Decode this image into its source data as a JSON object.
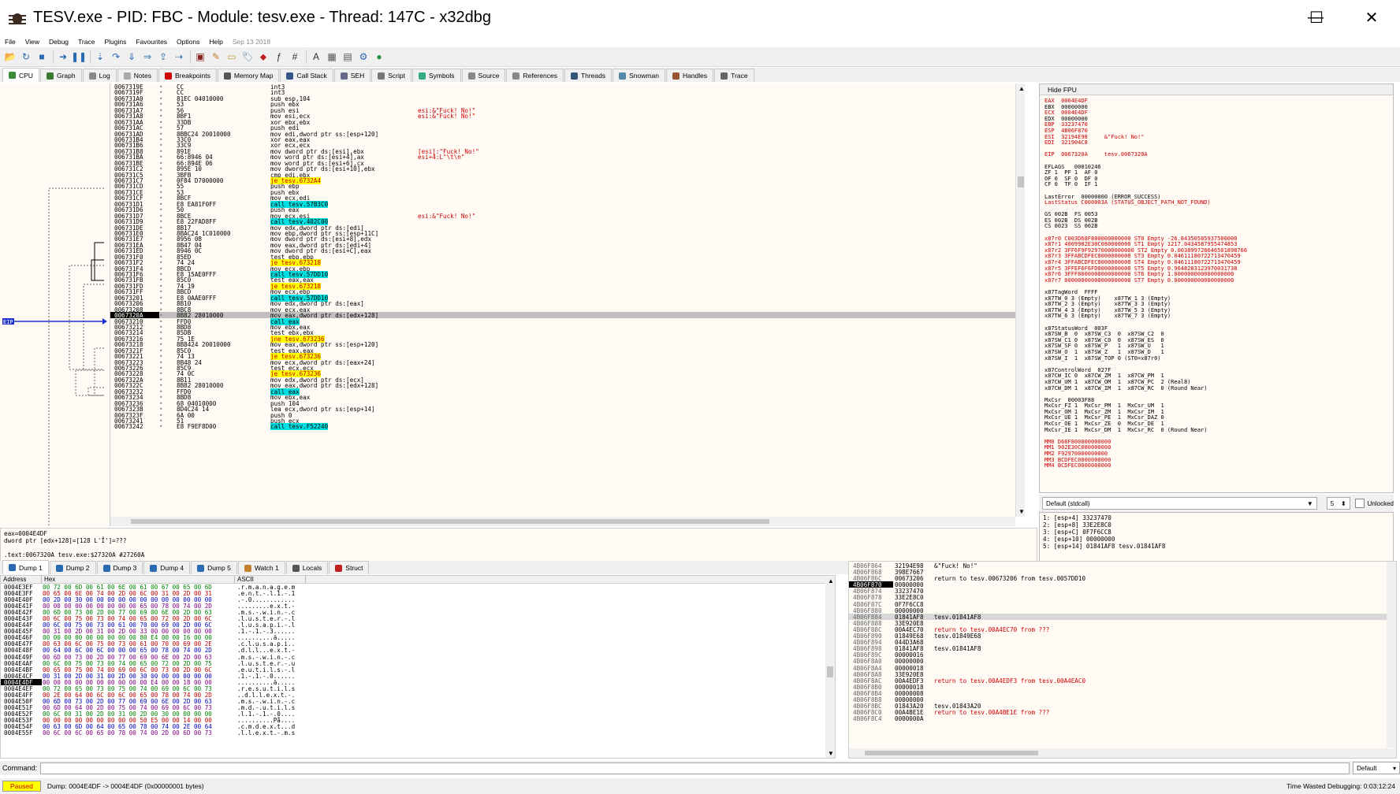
{
  "window": {
    "title": "TESV.exe - PID: FBC - Module: tesv.exe - Thread: 147C - x32dbg",
    "minimize": "—",
    "maximize": "☐",
    "close": "✕"
  },
  "menu": [
    "File",
    "View",
    "Debug",
    "Trace",
    "Plugins",
    "Favourites",
    "Options",
    "Help"
  ],
  "menu_date": "Sep 13 2018",
  "toolbar_icons": [
    "open-icon",
    "restart-icon",
    "stop-icon",
    "run-icon",
    "pause-icon",
    "step-into-icon",
    "step-over-icon",
    "trace-into-icon",
    "trace-over-icon",
    "execute-till-return-icon",
    "run-to-user-code-icon",
    "scylla-icon",
    "patch-icon",
    "comment-icon",
    "label-icon",
    "bookmark-icon",
    "function-icon",
    "hash-icon",
    "font-icon",
    "calculator-icon",
    "notes-icon",
    "settings-icon",
    "about-icon"
  ],
  "tabs": [
    {
      "label": "CPU",
      "color": "#3a8a3a"
    },
    {
      "label": "Graph",
      "color": "#3a7a30"
    },
    {
      "label": "Log",
      "color": "#888"
    },
    {
      "label": "Notes",
      "color": "#aaa"
    },
    {
      "label": "Breakpoints",
      "color": "#c00"
    },
    {
      "label": "Memory Map",
      "color": "#555"
    },
    {
      "label": "Call Stack",
      "color": "#358"
    },
    {
      "label": "SEH",
      "color": "#668"
    },
    {
      "label": "Script",
      "color": "#777"
    },
    {
      "label": "Symbols",
      "color": "#3a8"
    },
    {
      "label": "Source",
      "color": "#888"
    },
    {
      "label": "References",
      "color": "#888"
    },
    {
      "label": "Threads",
      "color": "#357"
    },
    {
      "label": "Snowman",
      "color": "#58a"
    },
    {
      "label": "Handles",
      "color": "#953"
    },
    {
      "label": "Trace",
      "color": "#666"
    }
  ],
  "disasm": [
    {
      "a": "0067319E",
      "b": "CC",
      "i": "int3",
      "c": "",
      "t": ""
    },
    {
      "a": "0067319F",
      "b": "CC",
      "i": "int3",
      "c": "",
      "t": ""
    },
    {
      "a": "006731A0",
      "b": "81EC 04010000",
      "i": "sub esp,104",
      "c": "",
      "t": ""
    },
    {
      "a": "006731A6",
      "b": "53",
      "i": "push ebx",
      "c": "",
      "t": ""
    },
    {
      "a": "006731A7",
      "b": "56",
      "i": "push esi",
      "c": "esi:&\"Fuck! No!\"",
      "t": ""
    },
    {
      "a": "006731A8",
      "b": "8BF1",
      "i": "mov esi,ecx",
      "c": "esi:&\"Fuck! No!\"",
      "t": ""
    },
    {
      "a": "006731AA",
      "b": "33DB",
      "i": "xor ebx,ebx",
      "c": "",
      "t": ""
    },
    {
      "a": "006731AC",
      "b": "57",
      "i": "push edi",
      "c": "",
      "t": ""
    },
    {
      "a": "006731AD",
      "b": "8BBC24 20010000",
      "i": "mov edi,dword ptr ss:[esp+120]",
      "c": "",
      "t": ""
    },
    {
      "a": "006731B4",
      "b": "33C0",
      "i": "xor eax,eax",
      "c": "",
      "t": ""
    },
    {
      "a": "006731B6",
      "b": "33C9",
      "i": "xor ecx,ecx",
      "c": "",
      "t": ""
    },
    {
      "a": "006731B8",
      "b": "891E",
      "i": "mov dword ptr ds:[esi],ebx",
      "c": "[esi]:\"Fuck! No!\"",
      "t": ""
    },
    {
      "a": "006731BA",
      "b": "66:8946 04",
      "i": "mov word ptr ds:[esi+4],ax",
      "c": "esi+4:L\"\\t\\n\"",
      "t": ""
    },
    {
      "a": "006731BE",
      "b": "66:894E 06",
      "i": "mov word ptr ds:[esi+6],cx",
      "c": "",
      "t": ""
    },
    {
      "a": "006731C2",
      "b": "895E 10",
      "i": "mov dword ptr ds:[esi+10],ebx",
      "c": "",
      "t": ""
    },
    {
      "a": "006731C5",
      "b": "3BFB",
      "i": "cmp edi,ebx",
      "c": "",
      "t": ""
    },
    {
      "a": "006731C7",
      "b": "0F84 D7000000",
      "i": "je tesv.6732A4",
      "c": "",
      "t": "j"
    },
    {
      "a": "006731CD",
      "b": "55",
      "i": "push ebp",
      "c": "",
      "t": ""
    },
    {
      "a": "006731CE",
      "b": "53",
      "i": "push ebx",
      "c": "",
      "t": ""
    },
    {
      "a": "006731CF",
      "b": "8BCF",
      "i": "mov ecx,edi",
      "c": "",
      "t": ""
    },
    {
      "a": "006731D1",
      "b": "E8 EA81F0FF",
      "i": "call tesv.57B3C0",
      "c": "",
      "t": "c"
    },
    {
      "a": "006731D6",
      "b": "50",
      "i": "push eax",
      "c": "",
      "t": ""
    },
    {
      "a": "006731D7",
      "b": "8BCE",
      "i": "mov ecx,esi",
      "c": "esi:&\"Fuck! No!\"",
      "t": ""
    },
    {
      "a": "006731D9",
      "b": "E8 22FAD8FF",
      "i": "call tesv.402C00",
      "c": "",
      "t": "c"
    },
    {
      "a": "006731DE",
      "b": "8B17",
      "i": "mov edx,dword ptr ds:[edi]",
      "c": "",
      "t": ""
    },
    {
      "a": "006731E0",
      "b": "8BAC24 1C010000",
      "i": "mov ebp,dword ptr ss:[esp+11C]",
      "c": "",
      "t": ""
    },
    {
      "a": "006731E7",
      "b": "8956 08",
      "i": "mov dword ptr ds:[esi+8],edx",
      "c": "",
      "t": ""
    },
    {
      "a": "006731EA",
      "b": "8B47 04",
      "i": "mov eax,dword ptr ds:[edi+4]",
      "c": "",
      "t": ""
    },
    {
      "a": "006731ED",
      "b": "8946 0C",
      "i": "mov dword ptr ds:[esi+C],eax",
      "c": "",
      "t": ""
    },
    {
      "a": "006731F0",
      "b": "85ED",
      "i": "test ebp,ebp",
      "c": "",
      "t": ""
    },
    {
      "a": "006731F2",
      "b": "74 24",
      "i": "je tesv.673218",
      "c": "",
      "t": "j"
    },
    {
      "a": "006731F4",
      "b": "8BCD",
      "i": "mov ecx,ebp",
      "c": "",
      "t": ""
    },
    {
      "a": "006731F6",
      "b": "E8 15AE0FFF",
      "i": "call tesv.57DD10",
      "c": "",
      "t": "c"
    },
    {
      "a": "006731FB",
      "b": "85C0",
      "i": "test eax,eax",
      "c": "",
      "t": ""
    },
    {
      "a": "006731FD",
      "b": "74 19",
      "i": "je tesv.673218",
      "c": "",
      "t": "j"
    },
    {
      "a": "006731FF",
      "b": "8BCD",
      "i": "mov ecx,ebp",
      "c": "",
      "t": ""
    },
    {
      "a": "00673201",
      "b": "E8 0AAE0FFF",
      "i": "call tesv.57DD10",
      "c": "",
      "t": "c"
    },
    {
      "a": "00673206",
      "b": "8B10",
      "i": "mov edx,dword ptr ds:[eax]",
      "c": "",
      "t": ""
    },
    {
      "a": "00673208",
      "b": "8BC8",
      "i": "mov ecx,eax",
      "c": "",
      "t": ""
    },
    {
      "a": "0067320A",
      "b": "8B82 28010000",
      "i": "mov eax,dword ptr ds:[edx+128]",
      "c": "",
      "t": "eip"
    },
    {
      "a": "00673210",
      "b": "FFD0",
      "i": "call eax",
      "c": "",
      "t": "c"
    },
    {
      "a": "00673212",
      "b": "8BD8",
      "i": "mov ebx,eax",
      "c": "",
      "t": ""
    },
    {
      "a": "00673214",
      "b": "85DB",
      "i": "test ebx,ebx",
      "c": "",
      "t": ""
    },
    {
      "a": "00673216",
      "b": "75 1E",
      "i": "jne tesv.673236",
      "c": "",
      "t": "j"
    },
    {
      "a": "00673218",
      "b": "8B8424 20010000",
      "i": "mov eax,dword ptr ss:[esp+120]",
      "c": "",
      "t": ""
    },
    {
      "a": "0067321F",
      "b": "85C0",
      "i": "test eax,eax",
      "c": "",
      "t": ""
    },
    {
      "a": "00673221",
      "b": "74 13",
      "i": "je tesv.673236",
      "c": "",
      "t": "j"
    },
    {
      "a": "00673223",
      "b": "8B48 24",
      "i": "mov ecx,dword ptr ds:[eax+24]",
      "c": "",
      "t": ""
    },
    {
      "a": "00673226",
      "b": "85C9",
      "i": "test ecx,ecx",
      "c": "",
      "t": ""
    },
    {
      "a": "00673228",
      "b": "74 0C",
      "i": "je tesv.673236",
      "c": "",
      "t": "j"
    },
    {
      "a": "0067322A",
      "b": "8B11",
      "i": "mov edx,dword ptr ds:[ecx]",
      "c": "",
      "t": ""
    },
    {
      "a": "0067322C",
      "b": "8B82 28010000",
      "i": "mov eax,dword ptr ds:[edx+128]",
      "c": "",
      "t": ""
    },
    {
      "a": "00673232",
      "b": "FFD0",
      "i": "call eax",
      "c": "",
      "t": "c"
    },
    {
      "a": "00673234",
      "b": "8BD8",
      "i": "mov ebx,eax",
      "c": "",
      "t": ""
    },
    {
      "a": "00673236",
      "b": "68 04010000",
      "i": "push 104",
      "c": "",
      "t": ""
    },
    {
      "a": "0067323B",
      "b": "8D4C24 14",
      "i": "lea ecx,dword ptr ss:[esp+14]",
      "c": "",
      "t": ""
    },
    {
      "a": "0067323F",
      "b": "6A 00",
      "i": "push 0",
      "c": "",
      "t": ""
    },
    {
      "a": "00673241",
      "b": "51",
      "i": "push ecx",
      "c": "",
      "t": ""
    },
    {
      "a": "00673242",
      "b": "E8 F9EF8D00",
      "i": "call tesv.F52240",
      "c": "",
      "t": "c"
    }
  ],
  "eip_label": "EIP",
  "regs_header": "Hide FPU",
  "regs": [
    "EAX  0004E4DF",
    "EBX  00000000",
    "ECX  0004E4DF",
    "EDX  00000000",
    "EBP  33237470",
    "ESP  4B06F870",
    "ESI  32194E98     &\"Fuck! No!\"",
    "EDI  321904C8",
    "",
    "EIP  0067320A     tesv.0067320A",
    "",
    "EFLAGS   00010246",
    "ZF 1  PF 1  AF 0",
    "OF 0  SF 0  DF 0",
    "CF 0  TF 0  IF 1",
    "",
    "LastError  00000000 (ERROR_SUCCESS)",
    "LastStatus C000003A (STATUS_OBJECT_PATH_NOT_FOUND)",
    "",
    "GS 002B  FS 0053",
    "ES 002B  DS 002B",
    "CS 0023  SS 002B",
    "",
    "x87r0 C003D68F800000000000 ST0 Empty -26.84350585937500000",
    "x87r1 4009902E30C080000000 ST1 Empty 1217.0434587955474853",
    "x87r2 3FF6F9F92970000000000 ST2 Empty 0.003899728646501898766",
    "x87r3 3FFABCDFEC0000000000 ST3 Empty 0.04611180722713470459",
    "x87r4 3FFABCDFEC0000000000 ST4 Empty 0.04611180722713470459",
    "x87r5 3FFEF6F6FD0000000000 ST5 Empty 0.9648283123970031738",
    "x87r6 3FFF8000000000000000 ST6 Empty 1.000000000000000000",
    "x87r7 00000000000000000000 ST7 Empty 0.000000000000000000",
    "",
    "x87TagWord  FFFF",
    "x87TW_0 3 (Empty)    x87TW_1 3 (Empty)",
    "x87TW_2 3 (Empty)    x87TW_3 3 (Empty)",
    "x87TW_4 3 (Empty)    x87TW_5 3 (Empty)",
    "x87TW_6 3 (Empty)    x87TW_7 3 (Empty)",
    "",
    "x87StatusWord  003F",
    "x87SW_B  0  x87SW_C3  0  x87SW_C2  0",
    "x87SW_C1 0  x87SW_C0  0  x87SW_ES  0",
    "x87SW_SF 0  x87SW_P   1  x87SW_U   1",
    "x87SW_O  1  x87SW_Z   1  x87SW_D   1",
    "x87SW_I  1  x87SW_TOP 0 (ST0=x87r0)",
    "",
    "x87ControlWord  027F",
    "x87CW_IC 0  x87CW_ZM  1  x87CW_PM  1",
    "x87CW_UM 1  x87CW_OM  1  x87CW_PC  2 (Real8)",
    "x87CW_DM 1  x87CW_IM  1  x87CW_RC  0 (Round Near)",
    "",
    "MxCsr  00003F88",
    "MxCsr_FZ 1  MxCsr_PM  1  MxCsr_UM  1",
    "MxCsr_OM 1  MxCsr_ZM  1  MxCsr_IM  1",
    "MxCsr_UE 1  MxCsr_PE  1  MxCsr_DAZ 0",
    "MxCsr_OE 1  MxCsr_ZE  0  MxCsr_DE  1",
    "MxCsr_IE 1  MxCsr_DM  1  MxCsr_RC  0 (Round Near)",
    "",
    "MM0 D68F800000000000",
    "MM1 902E30C080000000",
    "MM2 F92970000000000",
    "MM3 BCDFEC0000000000",
    "MM4 BCDFEC0000000000"
  ],
  "callconv": "Default (stdcall)",
  "arg_count": "5",
  "unlocked_label": "Unlocked",
  "callargs": [
    "1: [esp+4] 33237470",
    "2: [esp+8] 33E2E8C0",
    "3: [esp+C] 0F7F6CC8",
    "4: [esp+10] 00000000",
    "5: [esp+14] 01841AF8 tesv.01841AF8"
  ],
  "info": [
    "eax=0004E4DF",
    "dword ptr [edx+128]=[128 L'Ĩ']=???",
    "",
    ".text:0067320A tesv.exe:$27320A #27260A"
  ],
  "dump_tabs": [
    {
      "label": "Dump 1"
    },
    {
      "label": "Dump 2"
    },
    {
      "label": "Dump 3"
    },
    {
      "label": "Dump 4"
    },
    {
      "label": "Dump 5"
    },
    {
      "label": "Watch 1"
    },
    {
      "label": "Locals"
    },
    {
      "label": "Struct"
    }
  ],
  "dump_headers": {
    "address": "Address",
    "hex": "Hex",
    "ascii": "ASCII"
  },
  "dump": [
    {
      "a": "0004E3EF",
      "h": "00 72 00 6D 00 61 00 6E 00 61 00 67 00 65 00 6D",
      "s": ".r.m.a.n.a.g.e.m"
    },
    {
      "a": "0004E3FF",
      "h": "00 65 00 6E 00 74 00 2D 00 6C 00 31 00 2D 00 31",
      "s": ".e.n.t.-.l.1.-.1"
    },
    {
      "a": "0004E40F",
      "h": "00 2D 00 30 00 00 00 00 00 00 00 00 00 00 00 00",
      "s": ".-.0............"
    },
    {
      "a": "0004E41F",
      "h": "00 00 00 00 00 00 00 00 00 65 00 78 00 74 00 2D",
      "s": ".........e.x.t.-"
    },
    {
      "a": "0004E42F",
      "h": "00 6D 00 73 00 2D 00 77 00 69 00 6E 00 2D 00 63",
      "s": ".m.s.-.w.i.n.-.c"
    },
    {
      "a": "0004E43F",
      "h": "00 6C 00 75 00 73 00 74 00 65 00 72 00 2D 00 6C",
      "s": ".l.u.s.t.e.r.-.l"
    },
    {
      "a": "0004E44F",
      "h": "00 6C 00 75 00 73 00 61 00 70 00 69 00 2D 00 6C",
      "s": ".l.u.s.a.p.i.-.l"
    },
    {
      "a": "0004E45F",
      "h": "00 31 00 2D 00 31 00 2D 00 33 00 00 00 00 00 00",
      "s": ".1.-.1.-.3......"
    },
    {
      "a": "0004E46F",
      "h": "00 00 00 00 00 00 00 00 00 80 E4 00 00 16 00 00",
      "s": "..........ä....."
    },
    {
      "a": "0004E47F",
      "h": "00 63 00 6C 00 75 00 73 00 61 00 70 00 69 00 2E",
      "s": ".c.l.u.s.a.p.i.."
    },
    {
      "a": "0004E48F",
      "h": "00 64 00 6C 00 6C 00 00 00 65 00 78 00 74 00 2D",
      "s": ".d.l.l...e.x.t.-"
    },
    {
      "a": "0004E49F",
      "h": "00 6D 00 73 00 2D 00 77 00 69 00 6E 00 2D 00 63",
      "s": ".m.s.-.w.i.n.-.c"
    },
    {
      "a": "0004E4AF",
      "h": "00 6C 00 75 00 73 00 74 00 65 00 72 00 2D 00 75",
      "s": ".l.u.s.t.e.r.-.u"
    },
    {
      "a": "0004E4BF",
      "h": "00 65 00 75 00 74 00 69 00 6C 00 73 00 2D 00 6C",
      "s": ".e.u.t.i.l.s.-.l"
    },
    {
      "a": "0004E4CF",
      "h": "00 31 00 2D 00 31 00 2D 00 30 00 00 00 00 00 00",
      "s": ".1.-.1.-.0......"
    },
    {
      "a": "0004E4DF",
      "h": "00 00 00 00 00 00 00 00 00 00 E4 00 00 18 00 00",
      "s": "..........ä....."
    },
    {
      "a": "0004E4EF",
      "h": "00 72 00 65 00 73 00 75 00 74 00 69 00 6C 00 73",
      "s": ".r.e.s.u.t.i.l.s"
    },
    {
      "a": "0004E4FF",
      "h": "00 2E 00 64 00 6C 00 6C 00 65 00 78 00 74 00 2D",
      "s": "..d.l.l.e.x.t.-."
    },
    {
      "a": "0004E50F",
      "h": "00 6D 00 73 00 2D 00 77 00 69 00 6E 00 2D 00 63",
      "s": ".m.s.-.w.i.n.-.c"
    },
    {
      "a": "0004E51F",
      "h": "00 6D 00 64 00 2D 00 75 00 74 00 69 00 6C 00 73",
      "s": ".m.d.-.u.t.i.l.s"
    },
    {
      "a": "0004E52F",
      "h": "00 6C 00 31 00 2D 00 31 00 2D 00 30 00 00 00 00",
      "s": ".l.1.-.1.-.0...."
    },
    {
      "a": "0004E53F",
      "h": "00 00 00 00 00 00 00 00 00 50 E5 00 00 14 00 00",
      "s": "..........På...."
    },
    {
      "a": "0004E54F",
      "h": "00 63 00 6D 00 64 00 65 00 78 00 74 00 2E 00 64",
      "s": ".c.m.d.e.x.t...d"
    },
    {
      "a": "0004E55F",
      "h": "00 6C 00 6C 00 65 00 78 00 74 00 2D 00 6D 00 73",
      "s": ".l.l.e.x.t.-.m.s"
    }
  ],
  "stack": [
    {
      "a": "4B06F864",
      "v": "32194E98",
      "c": "&\"Fuck! No!\"",
      "red": false
    },
    {
      "a": "4B06F868",
      "v": "398E7667",
      "c": "",
      "red": false
    },
    {
      "a": "4B06F86C",
      "v": "00673206",
      "c": "return to tesv.00673206 from tesv.0057DD10",
      "red": false
    },
    {
      "a": "4B06F870",
      "v": "00000000",
      "c": "",
      "red": false,
      "cur": true
    },
    {
      "a": "4B06F874",
      "v": "33237470",
      "c": "",
      "red": false
    },
    {
      "a": "4B06F878",
      "v": "33E2E8C0",
      "c": "",
      "red": false
    },
    {
      "a": "4B06F87C",
      "v": "0F7F6CC8",
      "c": "",
      "red": false
    },
    {
      "a": "4B06F880",
      "v": "00000000",
      "c": "",
      "red": false
    },
    {
      "a": "4B06F884",
      "v": "01841AF8",
      "c": "tesv.01841AF8",
      "red": false,
      "sel": true
    },
    {
      "a": "4B06F888",
      "v": "33E920E8",
      "c": "",
      "red": false
    },
    {
      "a": "4B06F88C",
      "v": "00A4EC70",
      "c": "return to tesv.00A4EC70 from ???",
      "red": true
    },
    {
      "a": "4B06F890",
      "v": "01849E68",
      "c": "tesv.01849E68",
      "red": false
    },
    {
      "a": "4B06F894",
      "v": "044D3A68",
      "c": "",
      "red": false
    },
    {
      "a": "4B06F898",
      "v": "01841AF8",
      "c": "tesv.01841AF8",
      "red": false
    },
    {
      "a": "4B06F89C",
      "v": "00000016",
      "c": "",
      "red": false
    },
    {
      "a": "4B06F8A0",
      "v": "00000000",
      "c": "",
      "red": false
    },
    {
      "a": "4B06F8A4",
      "v": "00000018",
      "c": "",
      "red": false
    },
    {
      "a": "4B06F8A8",
      "v": "33E920E8",
      "c": "",
      "red": false
    },
    {
      "a": "4B06F8AC",
      "v": "00A4EDF3",
      "c": "return to tesv.00A4EDF3 from tesv.00A4EAC0",
      "red": true
    },
    {
      "a": "4B06F8B0",
      "v": "00000018",
      "c": "",
      "red": false
    },
    {
      "a": "4B06F8B4",
      "v": "00000008",
      "c": "",
      "red": false
    },
    {
      "a": "4B06F8B8",
      "v": "00000000",
      "c": "",
      "red": false
    },
    {
      "a": "4B06F8BC",
      "v": "01843A20",
      "c": "tesv.01843A20",
      "red": false
    },
    {
      "a": "4B06F8C0",
      "v": "00A4BE1E",
      "c": "return to tesv.00A4BE1E from ???",
      "red": true
    },
    {
      "a": "4B06F8C4",
      "v": "0000000A",
      "c": "",
      "red": false
    }
  ],
  "command_label": "Command:",
  "command_default": "Default",
  "status": {
    "state": "Paused",
    "message": "Dump: 0004E4DF -> 0004E4DF (0x00000001 bytes)",
    "time": "Time Wasted Debugging: 0:03:12:24"
  }
}
